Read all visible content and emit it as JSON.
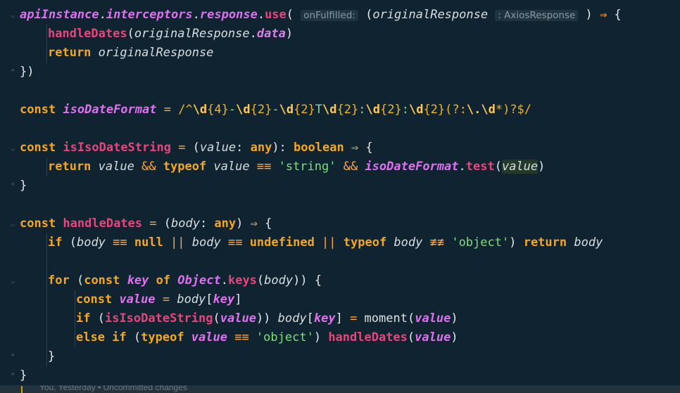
{
  "editor": {
    "lines": [
      {
        "fold": "start",
        "tokens": [
          {
            "t": "apiInstance",
            "c": "cst"
          },
          {
            "t": ".",
            "c": "pun"
          },
          {
            "t": "interceptors",
            "c": "cst"
          },
          {
            "t": ".",
            "c": "pun"
          },
          {
            "t": "response",
            "c": "cst"
          },
          {
            "t": ".",
            "c": "pun"
          },
          {
            "t": "use",
            "c": "fn"
          },
          {
            "t": "( ",
            "c": "pun"
          },
          {
            "t": "onFulfilled:",
            "c": "hint"
          },
          {
            "t": " (",
            "c": "pun"
          },
          {
            "t": "originalResponse",
            "c": "prm"
          },
          {
            "t": " ",
            "c": "pun"
          },
          {
            "t": ": AxiosResponse",
            "c": "hint"
          },
          {
            "t": " ) ",
            "c": "pun"
          },
          {
            "t": "⇒",
            "c": "op"
          },
          {
            "t": " {",
            "c": "pun"
          }
        ]
      },
      {
        "indent": 1,
        "tokens": [
          {
            "t": "handleDates",
            "c": "fn"
          },
          {
            "t": "(",
            "c": "pun"
          },
          {
            "t": "originalResponse",
            "c": "prm"
          },
          {
            "t": ".",
            "c": "pun"
          },
          {
            "t": "data",
            "c": "fnc"
          },
          {
            "t": ")",
            "c": "pun"
          }
        ]
      },
      {
        "indent": 1,
        "tokens": [
          {
            "t": "return ",
            "c": "kw"
          },
          {
            "t": "originalResponse",
            "c": "prm"
          }
        ]
      },
      {
        "fold": "end",
        "tokens": [
          {
            "t": "})",
            "c": "pun"
          }
        ]
      },
      {
        "tokens": []
      },
      {
        "tokens": [
          {
            "t": "const ",
            "c": "kw"
          },
          {
            "t": "isoDateFormat",
            "c": "cst"
          },
          {
            "t": " = ",
            "c": "op"
          },
          {
            "t": "/^",
            "c": "rx"
          },
          {
            "t": "\\d",
            "c": "rxd"
          },
          {
            "t": "{4}",
            "c": "rx"
          },
          {
            "t": "-",
            "c": "rxp"
          },
          {
            "t": "\\d",
            "c": "rxd"
          },
          {
            "t": "{2}",
            "c": "rx"
          },
          {
            "t": "-",
            "c": "rxp"
          },
          {
            "t": "\\d",
            "c": "rxd"
          },
          {
            "t": "{2}",
            "c": "rx"
          },
          {
            "t": "T",
            "c": "rxp"
          },
          {
            "t": "\\d",
            "c": "rxd"
          },
          {
            "t": "{2}",
            "c": "rx"
          },
          {
            "t": ":",
            "c": "rxp"
          },
          {
            "t": "\\d",
            "c": "rxd"
          },
          {
            "t": "{2}",
            "c": "rx"
          },
          {
            "t": ":",
            "c": "rxp"
          },
          {
            "t": "\\d",
            "c": "rxd"
          },
          {
            "t": "{2}",
            "c": "rx"
          },
          {
            "t": "(?:",
            "c": "rx"
          },
          {
            "t": "\\.\\d",
            "c": "rxd"
          },
          {
            "t": "*)?$/",
            "c": "rx"
          }
        ]
      },
      {
        "tokens": []
      },
      {
        "fold": "start",
        "tokens": [
          {
            "t": "const ",
            "c": "kw"
          },
          {
            "t": "isIsoDateString",
            "c": "fn"
          },
          {
            "t": " = ",
            "c": "op"
          },
          {
            "t": "(",
            "c": "pun"
          },
          {
            "t": "value",
            "c": "prm"
          },
          {
            "t": ": ",
            "c": "pun"
          },
          {
            "t": "any",
            "c": "kw"
          },
          {
            "t": "): ",
            "c": "pun"
          },
          {
            "t": "boolean",
            "c": "kw"
          },
          {
            "t": " ⇒ ",
            "c": "op"
          },
          {
            "t": "{",
            "c": "pun"
          }
        ]
      },
      {
        "indent": 1,
        "tokens": [
          {
            "t": "return ",
            "c": "kw"
          },
          {
            "t": "value",
            "c": "prm"
          },
          {
            "t": " && ",
            "c": "op"
          },
          {
            "t": "typeof ",
            "c": "kw"
          },
          {
            "t": "value",
            "c": "prm"
          },
          {
            "t": " ≡≡ ",
            "c": "op"
          },
          {
            "t": "'string'",
            "c": "str"
          },
          {
            "t": " && ",
            "c": "op"
          },
          {
            "t": "isoDateFormat",
            "c": "cst"
          },
          {
            "t": ".",
            "c": "pun"
          },
          {
            "t": "test",
            "c": "fn"
          },
          {
            "t": "(",
            "c": "pun"
          },
          {
            "t": "value",
            "c": "hl"
          },
          {
            "t": ")",
            "c": "pun"
          }
        ]
      },
      {
        "fold": "end",
        "tokens": [
          {
            "t": "}",
            "c": "pun"
          }
        ]
      },
      {
        "tokens": []
      },
      {
        "fold": "start",
        "tokens": [
          {
            "t": "const ",
            "c": "kw"
          },
          {
            "t": "handleDates",
            "c": "fn"
          },
          {
            "t": " = ",
            "c": "op"
          },
          {
            "t": "(",
            "c": "pun"
          },
          {
            "t": "body",
            "c": "prm"
          },
          {
            "t": ": ",
            "c": "pun"
          },
          {
            "t": "any",
            "c": "kw"
          },
          {
            "t": ") ",
            "c": "pun"
          },
          {
            "t": "⇒",
            "c": "op"
          },
          {
            "t": " {",
            "c": "pun"
          }
        ]
      },
      {
        "indent": 1,
        "tokens": [
          {
            "t": "if ",
            "c": "kw"
          },
          {
            "t": "(",
            "c": "pun"
          },
          {
            "t": "body",
            "c": "prm"
          },
          {
            "t": " ≡≡ ",
            "c": "op"
          },
          {
            "t": "null",
            "c": "kw"
          },
          {
            "t": " || ",
            "c": "op"
          },
          {
            "t": "body",
            "c": "prm"
          },
          {
            "t": " ≡≡ ",
            "c": "op"
          },
          {
            "t": "undefined",
            "c": "kw"
          },
          {
            "t": " || ",
            "c": "op"
          },
          {
            "t": "typeof ",
            "c": "kw"
          },
          {
            "t": "body",
            "c": "prm"
          },
          {
            "t": " ≢≢ ",
            "c": "op"
          },
          {
            "t": "'object'",
            "c": "str"
          },
          {
            "t": ") ",
            "c": "pun"
          },
          {
            "t": "return ",
            "c": "kw"
          },
          {
            "t": "body",
            "c": "prm"
          }
        ]
      },
      {
        "tokens": []
      },
      {
        "indent": 1,
        "fold": "start",
        "tokens": [
          {
            "t": "for ",
            "c": "kw"
          },
          {
            "t": "(",
            "c": "pun"
          },
          {
            "t": "const ",
            "c": "kw"
          },
          {
            "t": "key",
            "c": "cst"
          },
          {
            "t": " of ",
            "c": "kw"
          },
          {
            "t": "Object",
            "c": "cst"
          },
          {
            "t": ".",
            "c": "pun"
          },
          {
            "t": "keys",
            "c": "fn"
          },
          {
            "t": "(",
            "c": "pun"
          },
          {
            "t": "body",
            "c": "prm"
          },
          {
            "t": ")) {",
            "c": "pun"
          }
        ]
      },
      {
        "indent": 2,
        "tokens": [
          {
            "t": "const ",
            "c": "kw"
          },
          {
            "t": "value",
            "c": "cst"
          },
          {
            "t": " = ",
            "c": "op"
          },
          {
            "t": "body",
            "c": "prm"
          },
          {
            "t": "[",
            "c": "pun"
          },
          {
            "t": "key",
            "c": "cst"
          },
          {
            "t": "]",
            "c": "pun"
          }
        ]
      },
      {
        "indent": 2,
        "tokens": [
          {
            "t": "if ",
            "c": "kw"
          },
          {
            "t": "(",
            "c": "pun"
          },
          {
            "t": "isIsoDateString",
            "c": "fn"
          },
          {
            "t": "(",
            "c": "pun"
          },
          {
            "t": "value",
            "c": "cst"
          },
          {
            "t": ")) ",
            "c": "pun"
          },
          {
            "t": "body",
            "c": "prm"
          },
          {
            "t": "[",
            "c": "pun"
          },
          {
            "t": "key",
            "c": "cst"
          },
          {
            "t": "]",
            "c": "pun"
          },
          {
            "t": " = ",
            "c": "op"
          },
          {
            "t": "moment",
            "c": "plain"
          },
          {
            "t": "(",
            "c": "pun"
          },
          {
            "t": "value",
            "c": "cst"
          },
          {
            "t": ")",
            "c": "pun"
          }
        ]
      },
      {
        "indent": 2,
        "tokens": [
          {
            "t": "else if ",
            "c": "kw"
          },
          {
            "t": "(",
            "c": "pun"
          },
          {
            "t": "typeof ",
            "c": "kw"
          },
          {
            "t": "value",
            "c": "cst"
          },
          {
            "t": " ≡≡ ",
            "c": "op"
          },
          {
            "t": "'object'",
            "c": "str"
          },
          {
            "t": ") ",
            "c": "pun"
          },
          {
            "t": "handleDates",
            "c": "fn"
          },
          {
            "t": "(",
            "c": "pun"
          },
          {
            "t": "value",
            "c": "cst"
          },
          {
            "t": ")",
            "c": "pun"
          }
        ]
      },
      {
        "indent": 1,
        "fold": "end",
        "tokens": [
          {
            "t": "}",
            "c": "pun"
          }
        ]
      },
      {
        "fold": "end",
        "tokens": [
          {
            "t": "}",
            "c": "pun"
          }
        ]
      }
    ]
  },
  "status": {
    "blame": "You, Yesterday • Uncommitted changes"
  },
  "colors": {
    "background": "#0f2331",
    "keyword": "#f5a623",
    "function": "#e8457a",
    "constant": "#e070f0",
    "string": "#7ce07a",
    "regex": "#f0b429"
  }
}
